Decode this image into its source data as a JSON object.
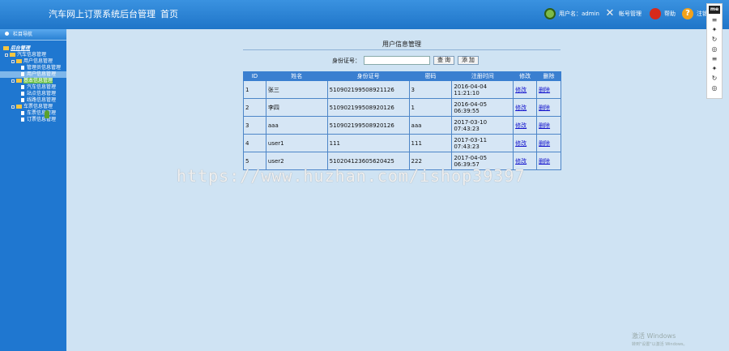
{
  "header": {
    "title": "汽车网上订票系统后台管理",
    "home": "首页",
    "user_label": "用户名：admin",
    "account_label": "帐号管理",
    "help_label": "帮助",
    "logout_label": "注销"
  },
  "sidebar": {
    "heading": "栏目导航",
    "tree": [
      {
        "label": "后台管理",
        "level": "root"
      },
      {
        "label": "汽车信息管理",
        "level": "l1"
      },
      {
        "label": "用户信息管理",
        "level": "l2"
      },
      {
        "label": "管理员信息管理",
        "level": "l3"
      },
      {
        "label": "用户信息管理",
        "level": "l3"
      },
      {
        "label": "基本信息管理",
        "level": "l2"
      },
      {
        "label": "汽车信息管理",
        "level": "l3"
      },
      {
        "label": "站点信息管理",
        "level": "l3"
      },
      {
        "label": "线路信息管理",
        "level": "l3"
      },
      {
        "label": "车票信息管理",
        "level": "l2"
      },
      {
        "label": "车票信息管理",
        "level": "l3"
      },
      {
        "label": "订票信息管理",
        "level": "l3"
      }
    ]
  },
  "main": {
    "title": "用户信息管理",
    "search_label": "身份证号：",
    "search_value": "",
    "query_button": "查 询",
    "add_button": "添 加"
  },
  "table": {
    "headers": [
      "ID",
      "姓名",
      "身份证号",
      "密码",
      "注册时间",
      "修改",
      "删除"
    ],
    "rows": [
      {
        "id": "1",
        "name": "张三",
        "idcard": "510902199508921126",
        "password": "3",
        "reg_date": "2016-04-04",
        "reg_time": "11:21:10",
        "edit": "修改",
        "delete": "删除"
      },
      {
        "id": "2",
        "name": "李四",
        "idcard": "510902199508920126",
        "password": "1",
        "reg_date": "2016-04-05",
        "reg_time": "06:39:55",
        "edit": "修改",
        "delete": "删除"
      },
      {
        "id": "3",
        "name": "aaa",
        "idcard": "510902199508920126",
        "password": "aaa",
        "reg_date": "2017-03-10",
        "reg_time": "07:43:23",
        "edit": "修改",
        "delete": "删除"
      },
      {
        "id": "4",
        "name": "user1",
        "idcard": "111",
        "password": "111",
        "reg_date": "2017-03-11",
        "reg_time": "07:43:23",
        "edit": "修改",
        "delete": "删除"
      },
      {
        "id": "5",
        "name": "user2",
        "idcard": "510204123605620425",
        "password": "222",
        "reg_date": "2017-04-05",
        "reg_time": "06:39:57",
        "edit": "修改",
        "delete": "删除"
      }
    ]
  },
  "watermark": "https://www.huzhan.com/ishop39397",
  "windows_activation": {
    "line1": "激活 Windows",
    "line2": "转到\"设置\"以激活 Windows。"
  },
  "right_toolbar": {
    "badge": "me"
  }
}
